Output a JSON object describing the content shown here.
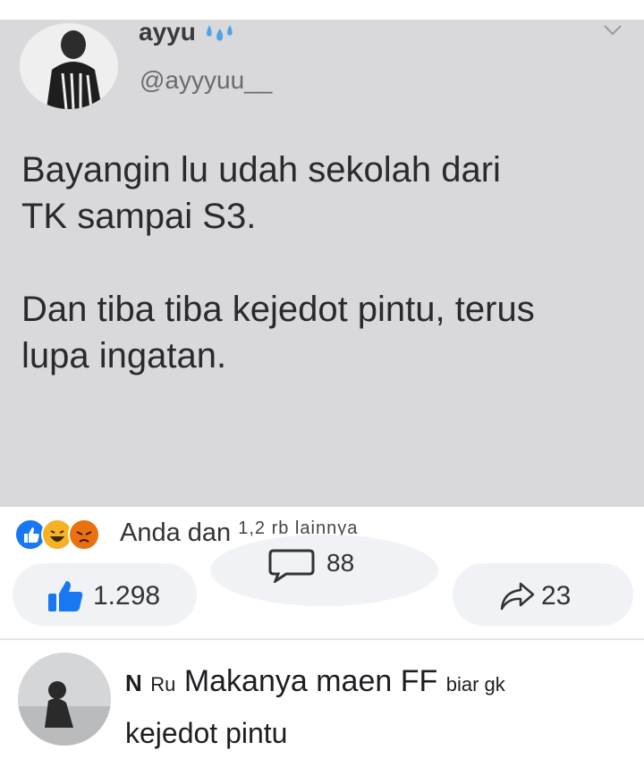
{
  "tweet": {
    "name": "ayyu",
    "handle": "@ayyyuu__",
    "text_line1": "Bayangin lu udah sekolah dari",
    "text_line2": "TK sampai S3.",
    "text_line3": "Dan tiba tiba kejedot pintu, terus",
    "text_line4": "lupa ingatan."
  },
  "reactions": {
    "icons": [
      "like-reaction",
      "haha-reaction",
      "angry-reaction"
    ],
    "summary_prefix": "Anda dan",
    "summary_faded": "1,2 rb lainnya"
  },
  "actions": {
    "comments_count": "88",
    "likes_count": "1.298",
    "shares_count": "23"
  },
  "comment": {
    "author": "N",
    "author_rest": "Ru",
    "text_line1": "Makanya maen FF",
    "text_line1_end": "biar gk",
    "text_line2": "kejedot pintu"
  },
  "colors": {
    "tweet_background": "#d9d9db",
    "like_blue": "#1877f2",
    "pill_background": "#f0f2f5"
  }
}
